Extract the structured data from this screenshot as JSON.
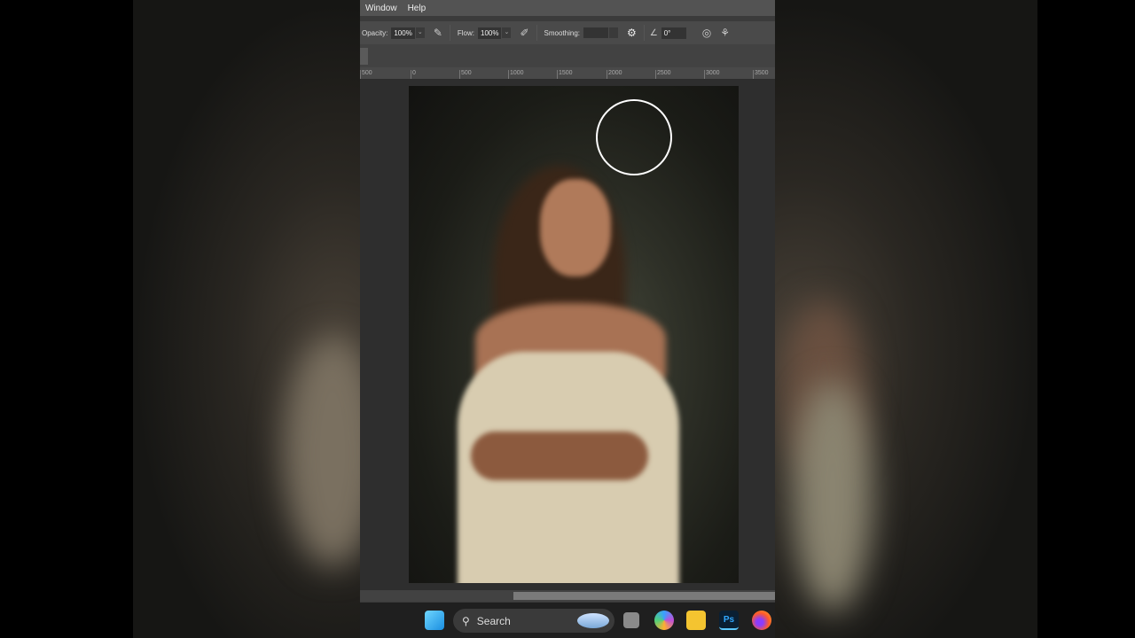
{
  "menu": {
    "items": [
      "Window",
      "Help"
    ]
  },
  "options": {
    "opacity_label": "Opacity:",
    "opacity_value": "100%",
    "flow_label": "Flow:",
    "flow_value": "100%",
    "smoothing_label": "Smoothing:",
    "smoothing_value": "",
    "angle_value": "0°"
  },
  "ruler": {
    "ticks": [
      "500",
      "0",
      "500",
      "1000",
      "1500",
      "2000",
      "2500",
      "3000",
      "3500"
    ]
  },
  "taskbar": {
    "search_placeholder": "Search",
    "apps": [
      "start",
      "task-view",
      "copilot",
      "file-explorer",
      "photoshop",
      "firefox"
    ],
    "photoshop_label": "Ps"
  }
}
